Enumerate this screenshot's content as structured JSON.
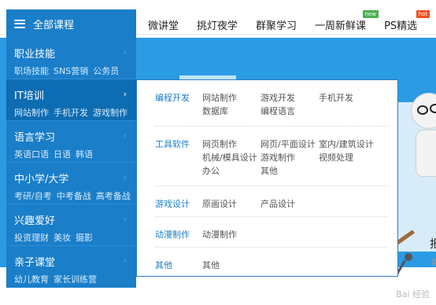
{
  "header": {
    "all_courses_label": "全部课程",
    "nav": [
      {
        "label": "微讲堂",
        "badge": ""
      },
      {
        "label": "挑灯夜学",
        "badge": ""
      },
      {
        "label": "群聚学习",
        "badge": ""
      },
      {
        "label": "一周新鲜课",
        "badge": "new"
      },
      {
        "label": "PS精选",
        "badge": "hot"
      }
    ]
  },
  "sidebar": {
    "categories": [
      {
        "title": "职业技能",
        "subs": [
          "职场技能",
          "SNS营销",
          "公务员"
        ]
      },
      {
        "title": "IT培训",
        "subs": [
          "网站制作",
          "手机开发",
          "游戏制作"
        ]
      },
      {
        "title": "语言学习",
        "subs": [
          "英语口语",
          "日语",
          "韩语"
        ]
      },
      {
        "title": "中小学/大学",
        "subs": [
          "考研/自考",
          "中考备战",
          "高考备战"
        ]
      },
      {
        "title": "兴趣爱好",
        "subs": [
          "投资理财",
          "美妆",
          "摄影"
        ]
      },
      {
        "title": "亲子课堂",
        "subs": [
          "幼儿教育",
          "家长训练营"
        ]
      }
    ],
    "arrow": "›"
  },
  "dropdown": {
    "groups": [
      {
        "title": "编程开发",
        "items": [
          "网站制作",
          "游戏开发",
          "手机开发",
          "数据库",
          "编程语言"
        ]
      },
      {
        "title": "工具软件",
        "items": [
          "网页制作",
          "网页/平面设计",
          "室内/建筑设计",
          "机械/模具设计",
          "游戏制作",
          "视频处理",
          "办公",
          "其他"
        ]
      },
      {
        "title": "游戏设计",
        "items": [
          "原画设计",
          "产品设计"
        ]
      },
      {
        "title": "动漫制作",
        "items": [
          "动漫制作"
        ]
      },
      {
        "title": "其他",
        "items": [
          "其他"
        ]
      }
    ]
  },
  "banner": {
    "side_char": "报",
    "side_char_small": "录"
  },
  "watermark": "Bai 经验"
}
